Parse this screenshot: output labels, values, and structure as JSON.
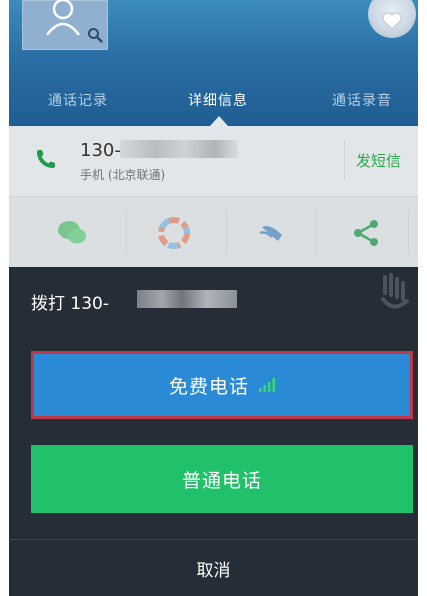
{
  "header": {
    "tabs": [
      {
        "label": "通话记录"
      },
      {
        "label": "详细信息"
      },
      {
        "label": "通话录音"
      }
    ]
  },
  "contact": {
    "number_prefix": "130-",
    "phone_type": "手机 (北京联通)",
    "sms_label": "发短信"
  },
  "dialog": {
    "title": "拨打 130-",
    "free_call_label": "免费电话",
    "normal_call_label": "普通电话",
    "cancel_label": "取消"
  },
  "colors": {
    "accent_blue": "#2a8ad6",
    "accent_green": "#21c06a",
    "highlight_red": "#c0394b"
  },
  "icons": [
    "person-icon",
    "magnifier-icon",
    "heart-icon",
    "phone-icon",
    "wechat-icon",
    "color-wheel-icon",
    "swipe-icon",
    "share-icon",
    "signal-icon"
  ]
}
